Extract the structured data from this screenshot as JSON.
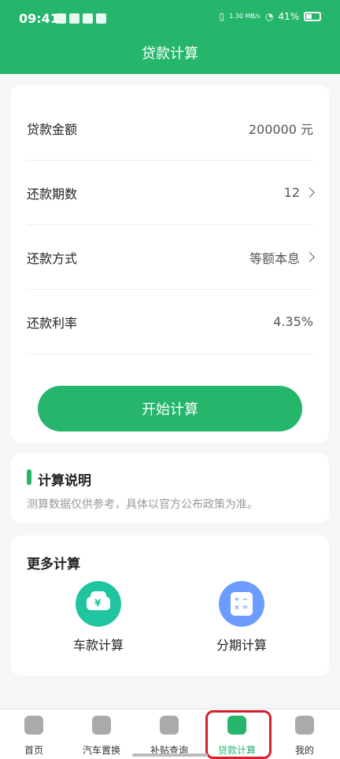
{
  "status_bar": {
    "time": "09:41",
    "speed": "1.30\nMB/s",
    "battery": "41%"
  },
  "header": {
    "title": "贷款计算"
  },
  "loan_form": {
    "rows": [
      {
        "label": "贷款金额",
        "value": "200000 元"
      },
      {
        "label": "还款期数",
        "value": "12"
      },
      {
        "label": "还款方式",
        "value": "等额本息"
      },
      {
        "label": "还款利率",
        "value": "4.35%"
      }
    ],
    "start_button": "开始计算"
  },
  "explanation": {
    "title": "计算说明",
    "description": "测算数据仅供参考，具体以官方公布政策为准。"
  },
  "more_calculations": {
    "title": "更多计算",
    "items": [
      {
        "label": "车款计算",
        "icon": "car-yen-icon",
        "color": "#20c5a0"
      },
      {
        "label": "分期计算",
        "icon": "calculator-icon",
        "color": "#6c9cff"
      }
    ]
  },
  "tab_bar": {
    "tabs": [
      {
        "label": "首页",
        "icon": "home-icon"
      },
      {
        "label": "汽车置换",
        "icon": "car-exchange-icon"
      },
      {
        "label": "补贴查询",
        "icon": "search-icon"
      },
      {
        "label": "贷款计算",
        "icon": "loan-calc-icon",
        "active": true
      },
      {
        "label": "我的",
        "icon": "user-icon"
      }
    ]
  },
  "colors": {
    "primary": "#25b66b",
    "highlight": "#d61f2c"
  }
}
